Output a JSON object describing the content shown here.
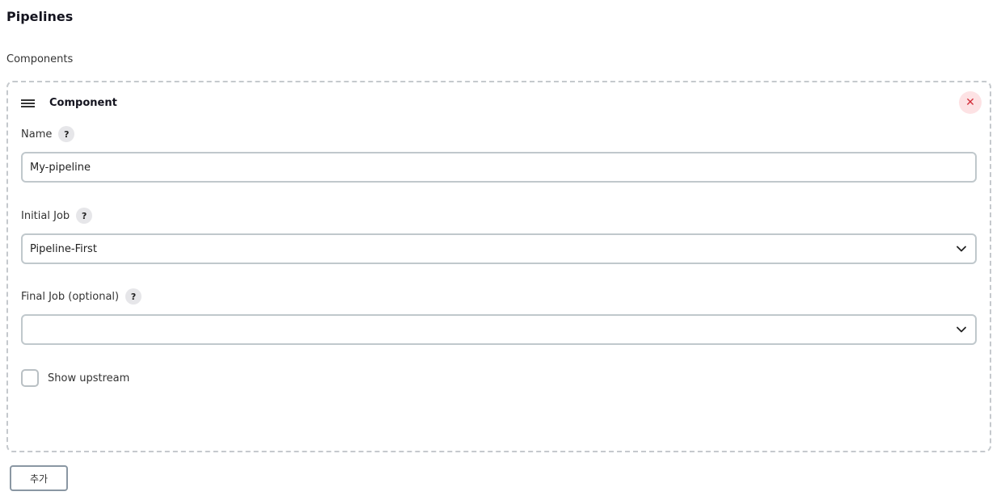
{
  "page": {
    "title": "Pipelines",
    "section_label": "Components"
  },
  "component": {
    "title": "Component",
    "icons": {
      "drag": "hamburger-drag-icon",
      "close": "close-icon",
      "help": "help-icon",
      "chevron": "chevron-down-icon"
    },
    "close_symbol": "✕",
    "help_symbol": "?",
    "name": {
      "label": "Name",
      "value": "My-pipeline"
    },
    "initial_job": {
      "label": "Initial Job",
      "selected": "Pipeline-First"
    },
    "final_job": {
      "label": "Final Job (optional)",
      "selected": ""
    },
    "show_upstream": {
      "label": "Show upstream",
      "checked": false
    }
  },
  "add_button": {
    "label": "추가"
  },
  "colors": {
    "close_bg": "#fde2e4",
    "close_fg": "#d32f3a",
    "border_dashed": "#c5c9cd",
    "input_border": "#c0c8cc"
  }
}
